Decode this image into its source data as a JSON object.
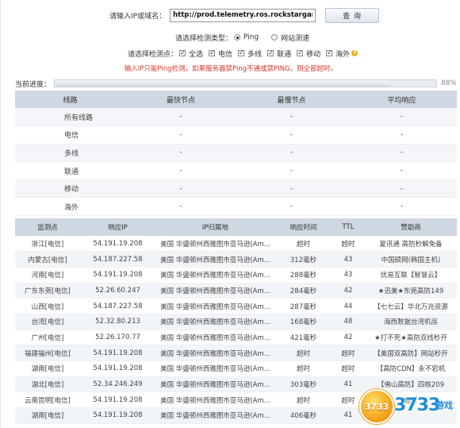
{
  "form": {
    "host_label": "请输入IP或域名：",
    "host_value": "http://prod.telemetry.ros.rockstargames.com",
    "query_button": "查 询",
    "type_label": "请选择检测类型：",
    "type_ping": "Ping",
    "type_web": "网站测速",
    "nodes_label": "请选择检测点：",
    "node_options": [
      "全选",
      "电信",
      "多线",
      "联通",
      "移动",
      "海外"
    ],
    "warning": "输入IP只能Ping检测，如果服务器禁Ping不通或禁PING，则全部超时。"
  },
  "progress": {
    "label": "当前进度：",
    "percent_text": "88%",
    "fraction": 0.88
  },
  "summary": {
    "headers": [
      "线路",
      "最快节点",
      "最慢节点",
      "平均响应"
    ],
    "rows": [
      [
        "所有线路",
        "-",
        "-",
        "-"
      ],
      [
        "电信",
        "-",
        "-",
        "-"
      ],
      [
        "多线",
        "-",
        "-",
        "-"
      ],
      [
        "联通",
        "-",
        "-",
        "-"
      ],
      [
        "移动",
        "-",
        "-",
        "-"
      ],
      [
        "海外",
        "-",
        "-",
        "-"
      ]
    ]
  },
  "results": {
    "headers": [
      "监测点",
      "响应IP",
      "IP归属地",
      "响应时间",
      "TTL",
      "赞助商"
    ],
    "rows": [
      [
        "浙江[电信]",
        "54.191.19.208",
        "美国 华盛顿州西雅图市亚马逊(Am...",
        "超时",
        "超时",
        "夏讯通 高防秒解免备"
      ],
      [
        "内蒙古[电信]",
        "54.187.227.58",
        "美国 华盛顿州西雅图市亚马逊(Am...",
        "312毫秒",
        "43",
        "中国硕网(韩国主机)"
      ],
      [
        "河南[电信]",
        "54.191.19.208",
        "美国 华盛顿州西雅图市亚马逊(Am...",
        "288毫秒",
        "43",
        "优易互联【智慧云】"
      ],
      [
        "广东东莞[电信]",
        "52.26.60.247",
        "美国 华盛顿州西雅图市亚马逊(Am...",
        "284毫秒",
        "42",
        "★迅美★东莞高防149"
      ],
      [
        "山西[电信]",
        "54.187.227.58",
        "美国 华盛顿州西雅图市亚马逊(Am...",
        "287毫秒",
        "44",
        "【七七云】华北万兆资源"
      ],
      [
        "台湾[电信]",
        "52.32.80.213",
        "美国 华盛顿州西雅图市亚马逊(Am...",
        "168毫秒",
        "48",
        "海西数据台湾机房"
      ],
      [
        "广州[电信]",
        "52.26.170.77",
        "美国 华盛顿州西雅图市亚马逊(Am...",
        "421毫秒",
        "42",
        "★打不死★高防双线秒开"
      ],
      [
        "福建福州[电信]",
        "54.191.19.208",
        "美国 华盛顿州西雅图市亚马逊(Am...",
        "超时",
        "超时",
        "【美国双高防】网站秒开"
      ],
      [
        "湖南[电信]",
        "54.191.19.208",
        "美国 华盛顿州西雅图市亚马逊(Am...",
        "超时",
        "超时",
        "【高防CDN】永不宕机"
      ],
      [
        "湖北[电信]",
        "52.34.246.249",
        "美国 华盛顿州西雅图市亚马逊(Am...",
        "303毫秒",
        "41",
        "【佛山高防】四核209"
      ],
      [
        "云南昆明[电信]",
        "54.191.19.208",
        "美国 华盛顿州西雅图市亚马逊(Am...",
        "超时",
        "超时",
        "超时"
      ],
      [
        "湖南[电信]",
        "54.191.19.208",
        "美国 华盛顿州西雅图市亚马逊(Am...",
        "406毫秒",
        "41",
        ""
      ]
    ]
  },
  "watermark": {
    "badge": "3733",
    "text": "3733",
    "sub": "游戏"
  }
}
